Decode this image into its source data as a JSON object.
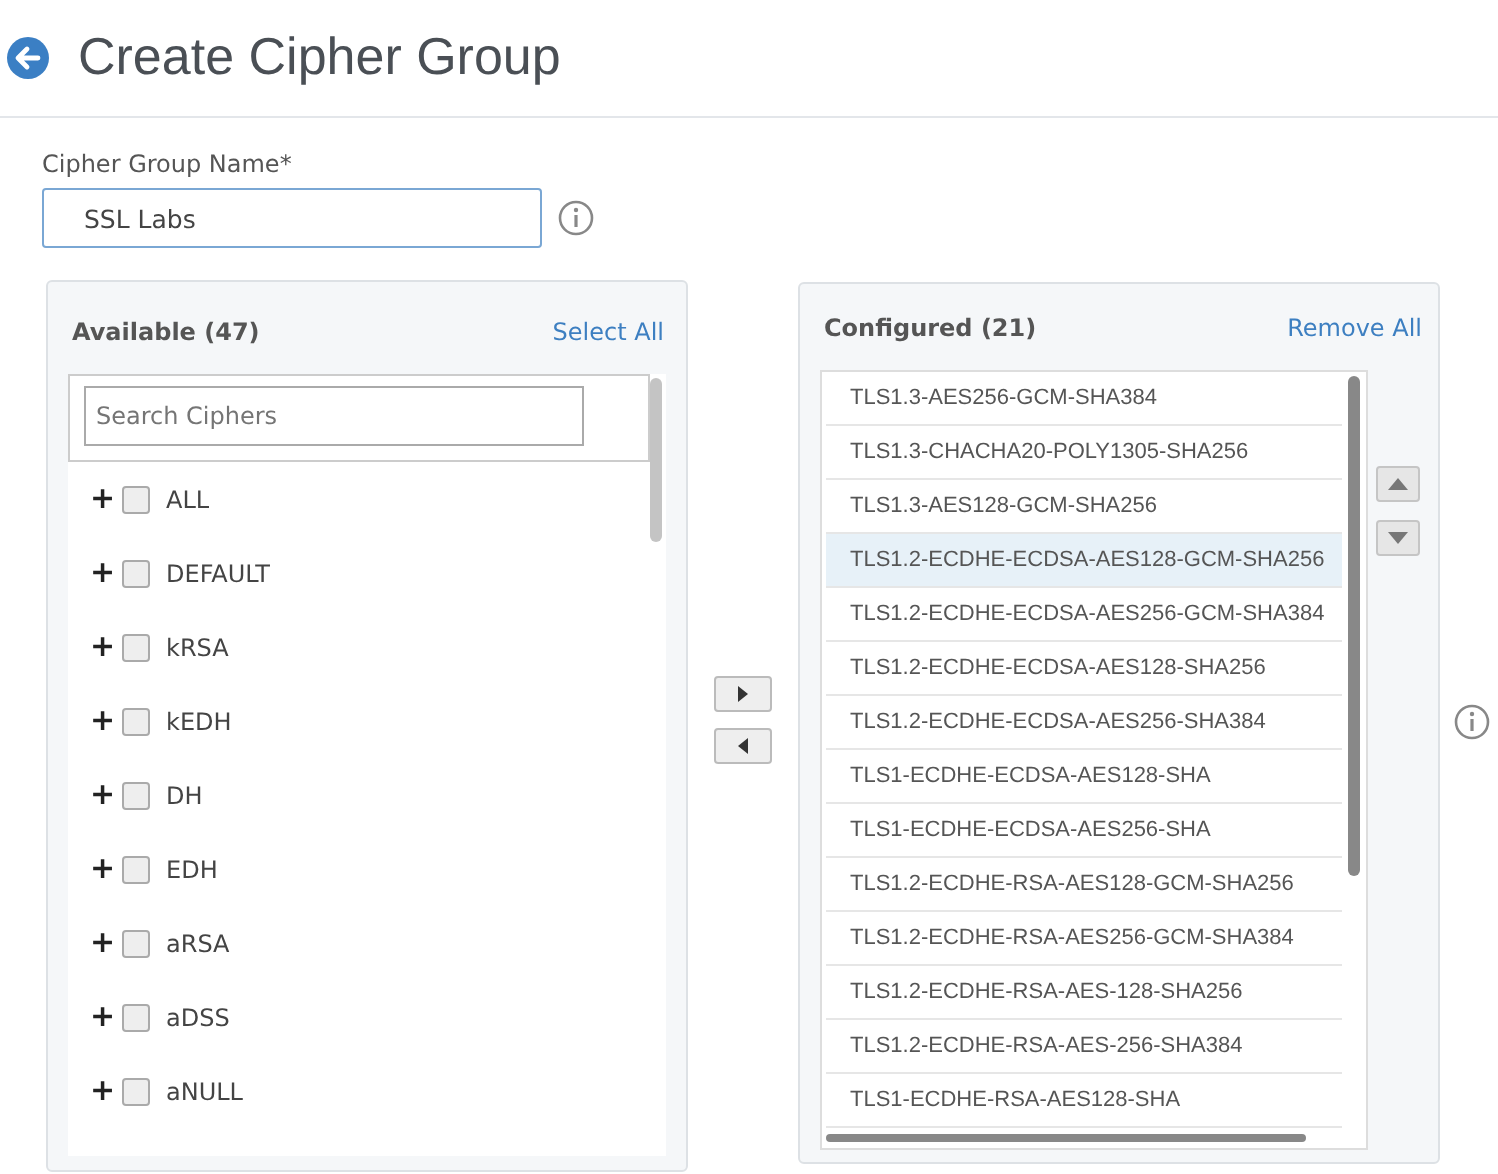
{
  "page": {
    "title": "Create Cipher Group"
  },
  "name_field": {
    "label": "Cipher Group Name*",
    "value": "SSL Labs"
  },
  "available": {
    "title": "Available (47)",
    "action": "Select All",
    "search": {
      "placeholder": "Search Ciphers"
    },
    "items": [
      {
        "expander": "+",
        "label": "ALL",
        "checked": false
      },
      {
        "expander": "+",
        "label": "DEFAULT",
        "checked": false
      },
      {
        "expander": "+",
        "label": "kRSA",
        "checked": false
      },
      {
        "expander": "+",
        "label": "kEDH",
        "checked": false
      },
      {
        "expander": "+",
        "label": "DH",
        "checked": false
      },
      {
        "expander": "+",
        "label": "EDH",
        "checked": false
      },
      {
        "expander": "+",
        "label": "aRSA",
        "checked": false
      },
      {
        "expander": "+",
        "label": "aDSS",
        "checked": false
      },
      {
        "expander": "+",
        "label": "aNULL",
        "checked": false
      }
    ]
  },
  "configured": {
    "title": "Configured (21)",
    "action": "Remove All",
    "items": [
      {
        "label": "TLS1.3-AES256-GCM-SHA384",
        "selected": false
      },
      {
        "label": "TLS1.3-CHACHA20-POLY1305-SHA256",
        "selected": false
      },
      {
        "label": "TLS1.3-AES128-GCM-SHA256",
        "selected": false
      },
      {
        "label": "TLS1.2-ECDHE-ECDSA-AES128-GCM-SHA256",
        "selected": true
      },
      {
        "label": "TLS1.2-ECDHE-ECDSA-AES256-GCM-SHA384",
        "selected": false
      },
      {
        "label": "TLS1.2-ECDHE-ECDSA-AES128-SHA256",
        "selected": false
      },
      {
        "label": "TLS1.2-ECDHE-ECDSA-AES256-SHA384",
        "selected": false
      },
      {
        "label": "TLS1-ECDHE-ECDSA-AES128-SHA",
        "selected": false
      },
      {
        "label": "TLS1-ECDHE-ECDSA-AES256-SHA",
        "selected": false
      },
      {
        "label": "TLS1.2-ECDHE-RSA-AES128-GCM-SHA256",
        "selected": false
      },
      {
        "label": "TLS1.2-ECDHE-RSA-AES256-GCM-SHA384",
        "selected": false
      },
      {
        "label": "TLS1.2-ECDHE-RSA-AES-128-SHA256",
        "selected": false
      },
      {
        "label": "TLS1.2-ECDHE-RSA-AES-256-SHA384",
        "selected": false
      },
      {
        "label": "TLS1-ECDHE-RSA-AES128-SHA",
        "selected": false
      }
    ]
  }
}
